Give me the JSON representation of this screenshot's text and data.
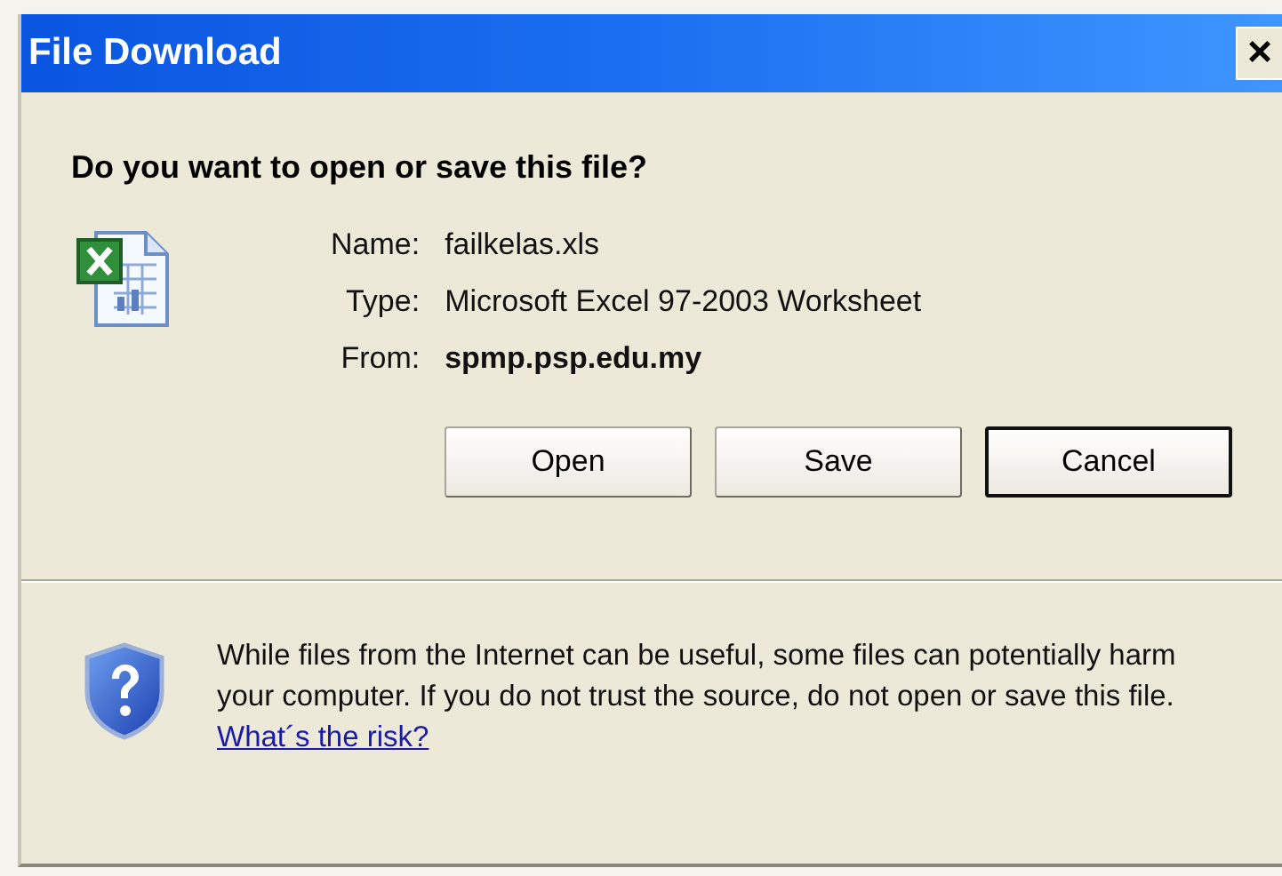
{
  "window": {
    "title": "File Download",
    "close": "×"
  },
  "question": "Do you want to open or save this file?",
  "file": {
    "fields": [
      {
        "label": "Name:",
        "value": "failkelas.xls",
        "bold": false
      },
      {
        "label": "Type:",
        "value": "Microsoft Excel 97-2003 Worksheet",
        "bold": false
      },
      {
        "label": "From:",
        "value": "spmp.psp.edu.my",
        "bold": true
      }
    ]
  },
  "buttons": [
    {
      "label": "Open",
      "default": false
    },
    {
      "label": "Save",
      "default": false
    },
    {
      "label": "Cancel",
      "default": true
    }
  ],
  "warning": {
    "text": "While files from the Internet can be useful, some files can potentially harm your computer. If you do not trust the source, do not open or save this file.",
    "link": "What´s the risk?"
  }
}
